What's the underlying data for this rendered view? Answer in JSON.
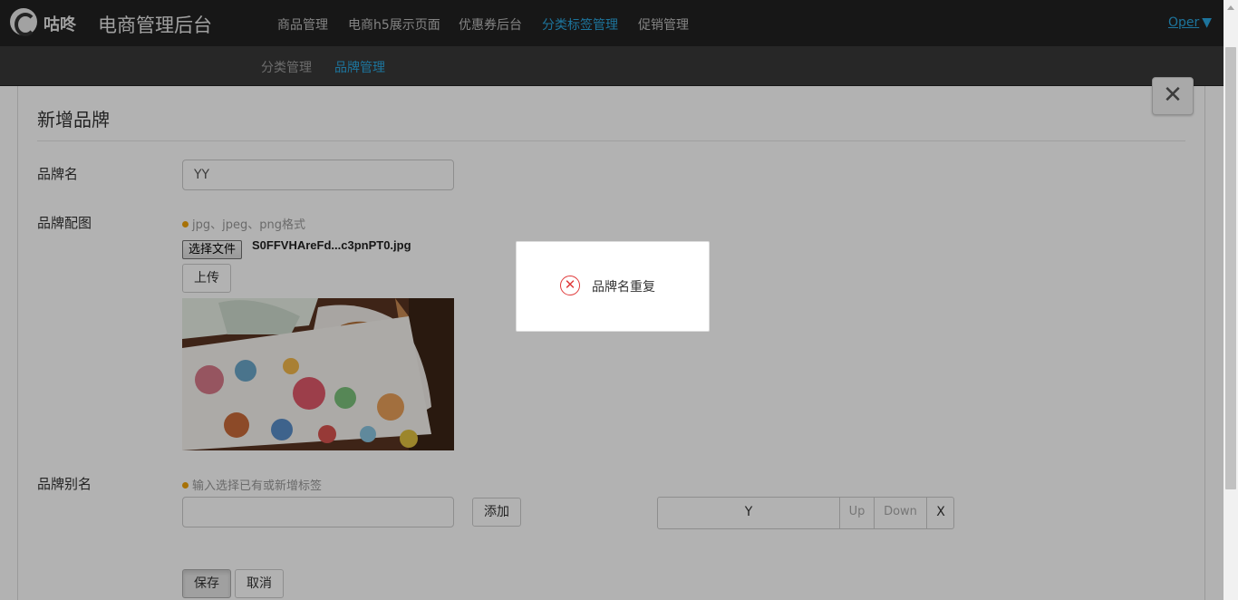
{
  "header": {
    "logo_text": "咕咚",
    "app_title": "电商管理后台",
    "nav": [
      {
        "label": "商品管理",
        "active": false
      },
      {
        "label": "电商h5展示页面",
        "active": false
      },
      {
        "label": "优惠券后台",
        "active": false
      },
      {
        "label": "分类标签管理",
        "active": true
      },
      {
        "label": "促销管理",
        "active": false
      }
    ],
    "user": "Oper",
    "user_caret": "▼"
  },
  "subnav": [
    {
      "label": "分类管理",
      "active": false
    },
    {
      "label": "品牌管理",
      "active": true
    }
  ],
  "form": {
    "title": "新增品牌",
    "close": "✕",
    "brand_name_label": "品牌名",
    "brand_name_value": "YY",
    "image_label": "品牌配图",
    "image_hint": "jpg、jpeg、png格式",
    "choose_file": "选择文件",
    "file_name": "S0FFVHAreFd...c3pnPT0.jpg",
    "upload": "上传",
    "alias_label": "品牌别名",
    "alias_hint": "输入选择已有或新增标签",
    "alias_input_value": "",
    "add": "添加",
    "tags": [
      {
        "name": "Y",
        "up": "Up",
        "down": "Down",
        "remove": "X"
      }
    ],
    "save": "保存",
    "cancel": "取消"
  },
  "toast": {
    "icon": "error-circle-icon",
    "message": "品牌名重复"
  },
  "colors": {
    "accent": "#2aa7e0",
    "error": "#e03b3b",
    "hint_dot": "#f0a30a"
  }
}
